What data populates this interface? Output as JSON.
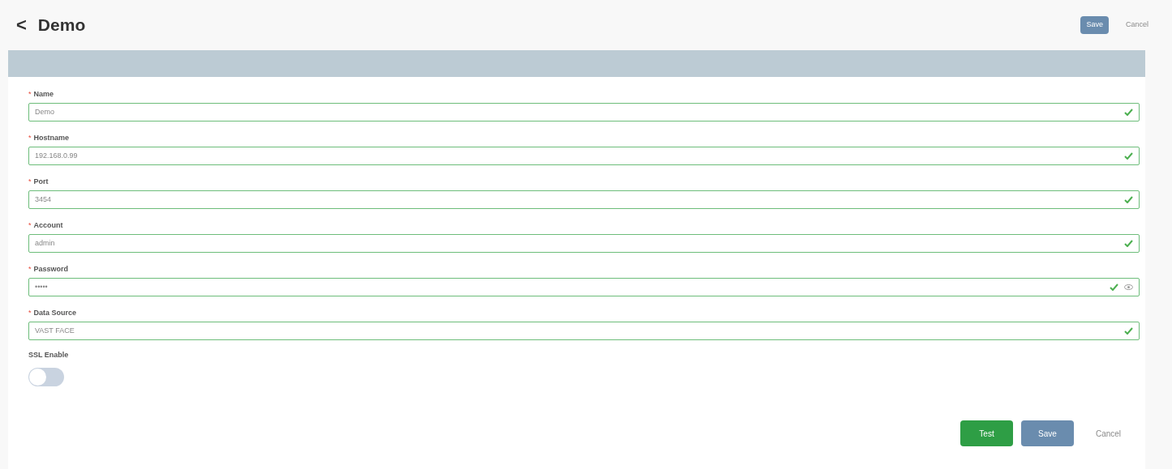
{
  "header": {
    "back": "<",
    "title": "Demo",
    "buttons": [
      {
        "kind": "primary",
        "label": "Save"
      },
      {
        "kind": "link",
        "label": "Cancel"
      }
    ]
  },
  "fields": [
    {
      "label": "Name",
      "required_mark": "*",
      "value": "Demo",
      "valid": true,
      "kind": "text"
    },
    {
      "label": "Hostname",
      "required_mark": "*",
      "value": "192.168.0.99",
      "valid": true,
      "kind": "text"
    },
    {
      "label": "Port",
      "required_mark": "*",
      "value": "3454",
      "valid": true,
      "kind": "text"
    },
    {
      "label": "Account",
      "required_mark": "*",
      "value": "admin",
      "valid": true,
      "kind": "text"
    },
    {
      "label": "Password",
      "required_mark": "*",
      "value": "•••••",
      "valid": true,
      "kind": "password"
    },
    {
      "label": "Data Source",
      "required_mark": "*",
      "value": "VAST FACE",
      "valid": true,
      "kind": "text"
    }
  ],
  "ssl": {
    "label": "SSL Enable",
    "on": false
  },
  "footer": {
    "buttons": [
      {
        "kind": "success",
        "label": "Test"
      },
      {
        "kind": "primary",
        "label": "Save"
      },
      {
        "kind": "link",
        "label": "Cancel"
      }
    ]
  }
}
